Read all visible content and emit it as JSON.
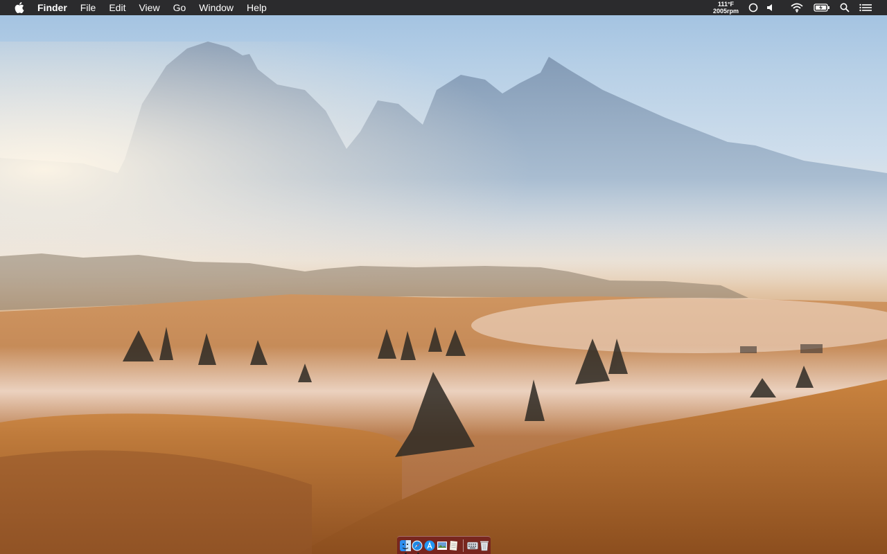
{
  "menubar": {
    "app_name": "Finder",
    "menus": [
      "File",
      "Edit",
      "View",
      "Go",
      "Window",
      "Help"
    ],
    "stats": {
      "temperature": "111°F",
      "fan_speed": "2005rpm"
    },
    "status_icons": [
      "circle-icon",
      "volume-icon",
      "wifi-icon",
      "battery-charging-icon",
      "spotlight-search-icon",
      "notification-center-icon"
    ]
  },
  "dock": {
    "apps": [
      {
        "name": "finder-icon",
        "running": true,
        "color": "#2f8ff0"
      },
      {
        "name": "safari-icon",
        "running": true,
        "color": "#1e88e5"
      },
      {
        "name": "app-store-icon",
        "running": false,
        "color": "#2196f3"
      },
      {
        "name": "preview-icon",
        "running": false,
        "color": "#6a9ed6"
      },
      {
        "name": "textedit-icon",
        "running": false,
        "color": "#f4f1e6"
      }
    ],
    "others": [
      {
        "name": "keyboard-icon",
        "running": false
      },
      {
        "name": "trash-icon",
        "running": false
      }
    ]
  },
  "colors": {
    "menubar_bg": "#2b2b2d",
    "dock_tint": "#6e141e"
  }
}
